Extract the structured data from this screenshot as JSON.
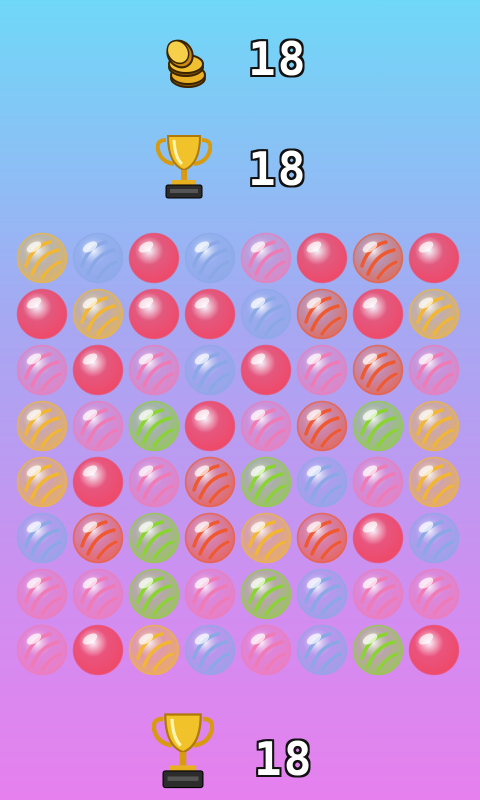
{
  "stats": {
    "coins": "18",
    "score": "18",
    "best": "18"
  },
  "icons": {
    "coins": "coin-stack-icon",
    "score": "trophy-icon",
    "best": "trophy-icon"
  },
  "palette": {
    "yellow": "#f2b630",
    "blue": "#8aa8e6",
    "red": "#ee4a6a",
    "orange": "#f0582e",
    "pink": "#f07ab4",
    "green": "#8ad430"
  },
  "board": [
    [
      "yellow",
      "blue",
      "red",
      "blue",
      "pink",
      "red",
      "orange",
      "red"
    ],
    [
      "red",
      "yellow",
      "red",
      "red",
      "blue",
      "orange",
      "red",
      "yellow"
    ],
    [
      "pink",
      "red",
      "pink",
      "blue",
      "red",
      "pink",
      "orange",
      "pink"
    ],
    [
      "yellow",
      "pink",
      "green",
      "red",
      "pink",
      "orange",
      "green",
      "yellow"
    ],
    [
      "yellow",
      "red",
      "pink",
      "orange",
      "green",
      "blue",
      "pink",
      "yellow"
    ],
    [
      "blue",
      "orange",
      "green",
      "orange",
      "yellow",
      "orange",
      "red",
      "blue"
    ],
    [
      "pink",
      "pink",
      "green",
      "pink",
      "green",
      "blue",
      "pink",
      "pink"
    ],
    [
      "pink",
      "red",
      "yellow",
      "blue",
      "pink",
      "blue",
      "green",
      "red"
    ]
  ]
}
